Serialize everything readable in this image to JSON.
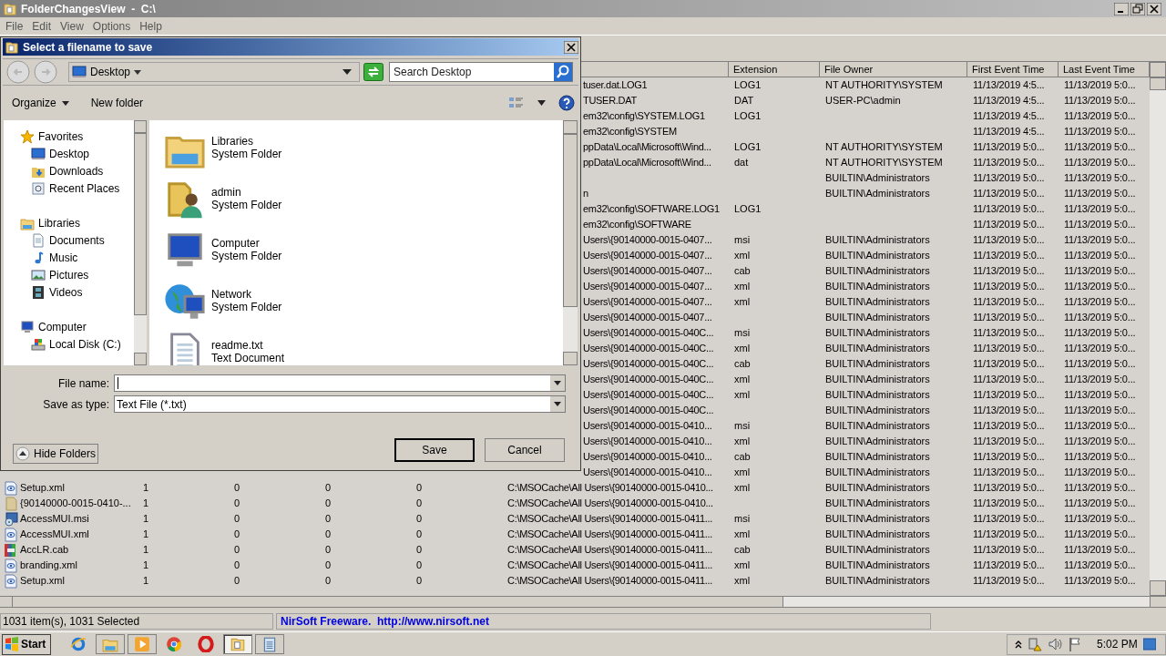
{
  "window": {
    "title": "FolderChangesView  -  C:\\"
  },
  "menu": [
    "File",
    "Edit",
    "View",
    "Options",
    "Help"
  ],
  "list": {
    "columns": [
      "Extension",
      "File Owner",
      "First Event Time",
      "Last Event Time"
    ],
    "rows": [
      {
        "path": "tuser.dat.LOG1",
        "extension": "LOG1",
        "owner": "NT AUTHORITY\\SYSTEM",
        "first_event": "11/13/2019 4:5...",
        "last_event": "11/13/2019 5:0..."
      },
      {
        "path": "TUSER.DAT",
        "extension": "DAT",
        "owner": "USER-PC\\admin",
        "first_event": "11/13/2019 4:5...",
        "last_event": "11/13/2019 5:0..."
      },
      {
        "path": "em32\\config\\SYSTEM.LOG1",
        "extension": "LOG1",
        "first_event": "11/13/2019 4:5...",
        "last_event": "11/13/2019 5:0..."
      },
      {
        "path": "em32\\config\\SYSTEM",
        "first_event": "11/13/2019 4:5...",
        "last_event": "11/13/2019 5:0..."
      },
      {
        "path": "ppData\\Local\\Microsoft\\Wind...",
        "extension": "LOG1",
        "owner": "NT AUTHORITY\\SYSTEM",
        "first_event": "11/13/2019 5:0...",
        "last_event": "11/13/2019 5:0..."
      },
      {
        "path": "ppData\\Local\\Microsoft\\Wind...",
        "extension": "dat",
        "owner": "NT AUTHORITY\\SYSTEM",
        "first_event": "11/13/2019 5:0...",
        "last_event": "11/13/2019 5:0..."
      },
      {
        "owner": "BUILTIN\\Administrators",
        "first_event": "11/13/2019 5:0...",
        "last_event": "11/13/2019 5:0..."
      },
      {
        "path": "n",
        "owner": "BUILTIN\\Administrators",
        "first_event": "11/13/2019 5:0...",
        "last_event": "11/13/2019 5:0..."
      },
      {
        "path": "em32\\config\\SOFTWARE.LOG1",
        "extension": "LOG1",
        "first_event": "11/13/2019 5:0...",
        "last_event": "11/13/2019 5:0..."
      },
      {
        "path": "em32\\config\\SOFTWARE",
        "first_event": "11/13/2019 5:0...",
        "last_event": "11/13/2019 5:0..."
      },
      {
        "path": "Users\\{90140000-0015-0407...",
        "extension": "msi",
        "owner": "BUILTIN\\Administrators",
        "first_event": "11/13/2019 5:0...",
        "last_event": "11/13/2019 5:0..."
      },
      {
        "path": "Users\\{90140000-0015-0407...",
        "extension": "xml",
        "owner": "BUILTIN\\Administrators",
        "first_event": "11/13/2019 5:0...",
        "last_event": "11/13/2019 5:0..."
      },
      {
        "path": "Users\\{90140000-0015-0407...",
        "extension": "cab",
        "owner": "BUILTIN\\Administrators",
        "first_event": "11/13/2019 5:0...",
        "last_event": "11/13/2019 5:0..."
      },
      {
        "path": "Users\\{90140000-0015-0407...",
        "extension": "xml",
        "owner": "BUILTIN\\Administrators",
        "first_event": "11/13/2019 5:0...",
        "last_event": "11/13/2019 5:0..."
      },
      {
        "path": "Users\\{90140000-0015-0407...",
        "extension": "xml",
        "owner": "BUILTIN\\Administrators",
        "first_event": "11/13/2019 5:0...",
        "last_event": "11/13/2019 5:0..."
      },
      {
        "path": "Users\\{90140000-0015-0407...",
        "owner": "BUILTIN\\Administrators",
        "first_event": "11/13/2019 5:0...",
        "last_event": "11/13/2019 5:0..."
      },
      {
        "path": "Users\\{90140000-0015-040C...",
        "extension": "msi",
        "owner": "BUILTIN\\Administrators",
        "first_event": "11/13/2019 5:0...",
        "last_event": "11/13/2019 5:0..."
      },
      {
        "path": "Users\\{90140000-0015-040C...",
        "extension": "xml",
        "owner": "BUILTIN\\Administrators",
        "first_event": "11/13/2019 5:0...",
        "last_event": "11/13/2019 5:0..."
      },
      {
        "path": "Users\\{90140000-0015-040C...",
        "extension": "cab",
        "owner": "BUILTIN\\Administrators",
        "first_event": "11/13/2019 5:0...",
        "last_event": "11/13/2019 5:0..."
      },
      {
        "path": "Users\\{90140000-0015-040C...",
        "extension": "xml",
        "owner": "BUILTIN\\Administrators",
        "first_event": "11/13/2019 5:0...",
        "last_event": "11/13/2019 5:0..."
      },
      {
        "path": "Users\\{90140000-0015-040C...",
        "extension": "xml",
        "owner": "BUILTIN\\Administrators",
        "first_event": "11/13/2019 5:0...",
        "last_event": "11/13/2019 5:0..."
      },
      {
        "path": "Users\\{90140000-0015-040C...",
        "owner": "BUILTIN\\Administrators",
        "first_event": "11/13/2019 5:0...",
        "last_event": "11/13/2019 5:0..."
      },
      {
        "path": "Users\\{90140000-0015-0410...",
        "extension": "msi",
        "owner": "BUILTIN\\Administrators",
        "first_event": "11/13/2019 5:0...",
        "last_event": "11/13/2019 5:0..."
      },
      {
        "path": "Users\\{90140000-0015-0410...",
        "extension": "xml",
        "owner": "BUILTIN\\Administrators",
        "first_event": "11/13/2019 5:0...",
        "last_event": "11/13/2019 5:0..."
      },
      {
        "path": "Users\\{90140000-0015-0410...",
        "extension": "cab",
        "owner": "BUILTIN\\Administrators",
        "first_event": "11/13/2019 5:0...",
        "last_event": "11/13/2019 5:0..."
      },
      {
        "path": "Users\\{90140000-0015-0410...",
        "extension": "xml",
        "owner": "BUILTIN\\Administrators",
        "first_event": "11/13/2019 5:0...",
        "last_event": "11/13/2019 5:0..."
      },
      {
        "kind": "xml",
        "name": "Setup.xml",
        "column_2": "1",
        "column_3": "0",
        "column_4": "0",
        "column_5": "0",
        "path": "C:\\MSOCache\\All Users\\{90140000-0015-0410...",
        "extension": "xml",
        "owner": "BUILTIN\\Administrators",
        "first_event": "11/13/2019 5:0...",
        "last_event": "11/13/2019 5:0..."
      },
      {
        "kind": "folder",
        "name": "{90140000-0015-0410-...",
        "column_2": "1",
        "column_3": "0",
        "column_4": "0",
        "column_5": "0",
        "path": "C:\\MSOCache\\All Users\\{90140000-0015-0410...",
        "owner": "BUILTIN\\Administrators",
        "first_event": "11/13/2019 5:0...",
        "last_event": "11/13/2019 5:0..."
      },
      {
        "kind": "msi",
        "name": "AccessMUI.msi",
        "column_2": "1",
        "column_3": "0",
        "column_4": "0",
        "column_5": "0",
        "path": "C:\\MSOCache\\All Users\\{90140000-0015-0411...",
        "extension": "msi",
        "owner": "BUILTIN\\Administrators",
        "first_event": "11/13/2019 5:0...",
        "last_event": "11/13/2019 5:0..."
      },
      {
        "kind": "xml",
        "name": "AccessMUI.xml",
        "column_2": "1",
        "column_3": "0",
        "column_4": "0",
        "column_5": "0",
        "path": "C:\\MSOCache\\All Users\\{90140000-0015-0411...",
        "extension": "xml",
        "owner": "BUILTIN\\Administrators",
        "first_event": "11/13/2019 5:0...",
        "last_event": "11/13/2019 5:0..."
      },
      {
        "kind": "cab",
        "name": "AccLR.cab",
        "column_2": "1",
        "column_3": "0",
        "column_4": "0",
        "column_5": "0",
        "path": "C:\\MSOCache\\All Users\\{90140000-0015-0411...",
        "extension": "cab",
        "owner": "BUILTIN\\Administrators",
        "first_event": "11/13/2019 5:0...",
        "last_event": "11/13/2019 5:0..."
      },
      {
        "kind": "xml",
        "name": "branding.xml",
        "column_2": "1",
        "column_3": "0",
        "column_4": "0",
        "column_5": "0",
        "path": "C:\\MSOCache\\All Users\\{90140000-0015-0411...",
        "extension": "xml",
        "owner": "BUILTIN\\Administrators",
        "first_event": "11/13/2019 5:0...",
        "last_event": "11/13/2019 5:0..."
      },
      {
        "kind": "xml",
        "name": "Setup.xml",
        "column_2": "1",
        "column_3": "0",
        "column_4": "0",
        "column_5": "0",
        "path": "C:\\MSOCache\\All Users\\{90140000-0015-0411...",
        "extension": "xml",
        "owner": "BUILTIN\\Administrators",
        "first_event": "11/13/2019 5:0...",
        "last_event": "11/13/2019 5:0..."
      }
    ]
  },
  "status_bar": {
    "count": "1031 item(s), 1031 Selected",
    "credit": "NirSoft Freeware.  http://www.nirsoft.net"
  },
  "dialog": {
    "title": "Select a filename to save",
    "location": "Desktop",
    "search": {
      "placeholder": "Search Desktop"
    },
    "toolbar": {
      "organize": "Organize",
      "new_folder": "New folder"
    },
    "nav": [
      {
        "kind": "star",
        "label": "Favorites",
        "children": [
          {
            "kind": "desktop",
            "label": "Desktop"
          },
          {
            "kind": "downloads",
            "label": "Downloads"
          },
          {
            "kind": "recent",
            "label": "Recent Places"
          }
        ]
      },
      {
        "kind": "library",
        "label": "Libraries",
        "children": [
          {
            "kind": "documents",
            "label": "Documents"
          },
          {
            "kind": "music",
            "label": "Music"
          },
          {
            "kind": "pictures",
            "label": "Pictures"
          },
          {
            "kind": "videos",
            "label": "Videos"
          }
        ]
      },
      {
        "kind": "computer",
        "label": "Computer",
        "children": [
          {
            "kind": "disk",
            "label": "Local Disk (C:)"
          }
        ]
      }
    ],
    "files": [
      {
        "kind": "library",
        "name": "Libraries",
        "type": "System Folder"
      },
      {
        "kind": "user-folder",
        "name": "admin",
        "type": "System Folder"
      },
      {
        "kind": "computer",
        "name": "Computer",
        "type": "System Folder"
      },
      {
        "kind": "network",
        "name": "Network",
        "type": "System Folder"
      },
      {
        "kind": "text",
        "name": "readme.txt",
        "type": "Text Document"
      }
    ],
    "file_name": {
      "label": "File name:"
    },
    "save_as_type": {
      "label": "Save as type:",
      "value": "Text File (*.txt)"
    },
    "hide_folders": "Hide Folders",
    "buttons": [
      "Save",
      "Cancel"
    ]
  },
  "taskbar": {
    "start": "Start",
    "apps": [
      {
        "kind": "ie",
        "open": false,
        "active": false
      },
      {
        "kind": "explorer",
        "open": true,
        "active": false
      },
      {
        "kind": "media",
        "open": true,
        "active": false
      },
      {
        "kind": "chrome",
        "open": false,
        "active": false
      },
      {
        "kind": "opera",
        "open": false,
        "active": false
      },
      {
        "kind": "app",
        "open": true,
        "active": true
      },
      {
        "kind": "notepad",
        "open": true,
        "active": false
      }
    ],
    "clock": "5:02 PM"
  }
}
